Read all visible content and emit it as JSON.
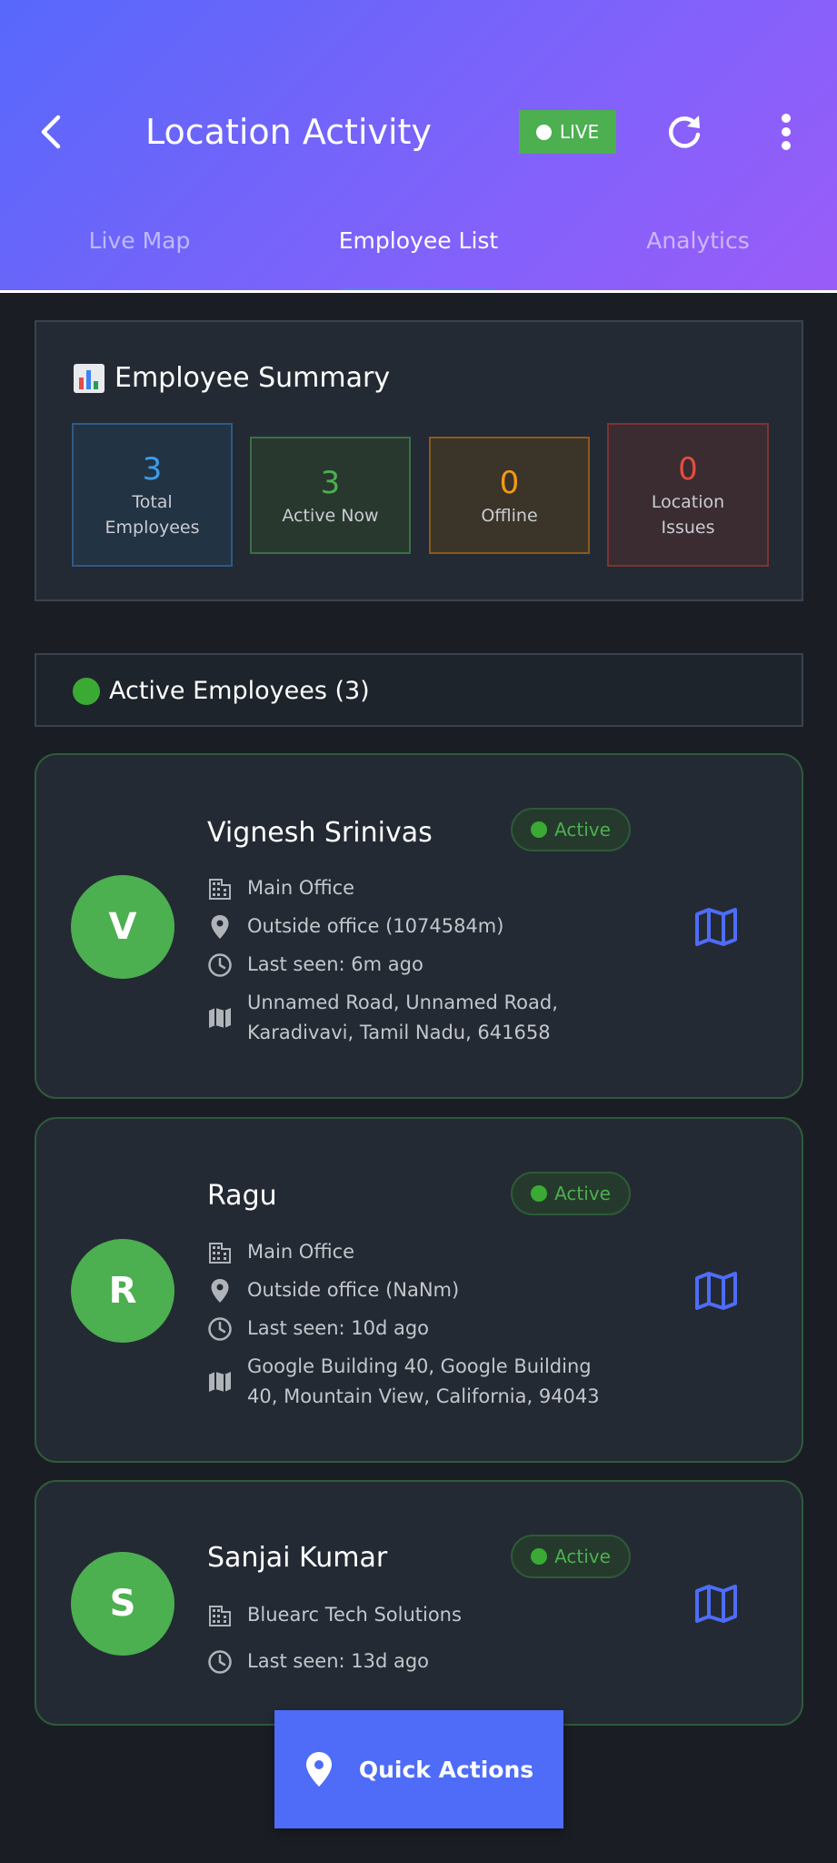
{
  "header": {
    "title": "Location Activity",
    "live_label": "LIVE",
    "colors": {
      "gradient_start": "#5768fb",
      "gradient_end": "#9a5cf9",
      "live": "#4caf50"
    }
  },
  "tabs": [
    {
      "label": "Live Map",
      "active": false
    },
    {
      "label": "Employee List",
      "active": true
    },
    {
      "label": "Analytics",
      "active": false
    }
  ],
  "summary": {
    "icon": "bar-chart-icon",
    "title": "Employee Summary",
    "stats": [
      {
        "value": "3",
        "label_line1": "Total",
        "label_line2": "Employees",
        "color": "#3b9ded"
      },
      {
        "value": "3",
        "label_line1": "Active Now",
        "label_line2": "",
        "color": "#4caf50"
      },
      {
        "value": "0",
        "label_line1": "Offline",
        "label_line2": "",
        "color": "#f39c12"
      },
      {
        "value": "0",
        "label_line1": "Location",
        "label_line2": "Issues",
        "color": "#e74c3c"
      }
    ]
  },
  "section": {
    "title": "Active Employees (3)"
  },
  "employees": [
    {
      "initial": "V",
      "name": "Vignesh Srinivas",
      "status": "Active",
      "office": "Main Office",
      "location": "Outside office (1074584m)",
      "last_seen": "Last seen: 6m ago",
      "address_line1": "Unnamed Road, Unnamed Road,",
      "address_line2": "Karadivavi, Tamil Nadu, 641658"
    },
    {
      "initial": "R",
      "name": "Ragu",
      "status": "Active",
      "office": "Main Office",
      "location": "Outside office (NaNm)",
      "last_seen": "Last seen: 10d ago",
      "address_line1": "Google Building 40, Google Building",
      "address_line2": "40, Mountain View, California, 94043"
    },
    {
      "initial": "S",
      "name": "Sanjai Kumar",
      "status": "Active",
      "office": "Bluearc Tech Solutions",
      "last_seen": "Last seen: 13d ago"
    }
  ],
  "fab": {
    "label": "Quick Actions",
    "icon": "location-pin-icon",
    "color": "#4e6cf7"
  }
}
